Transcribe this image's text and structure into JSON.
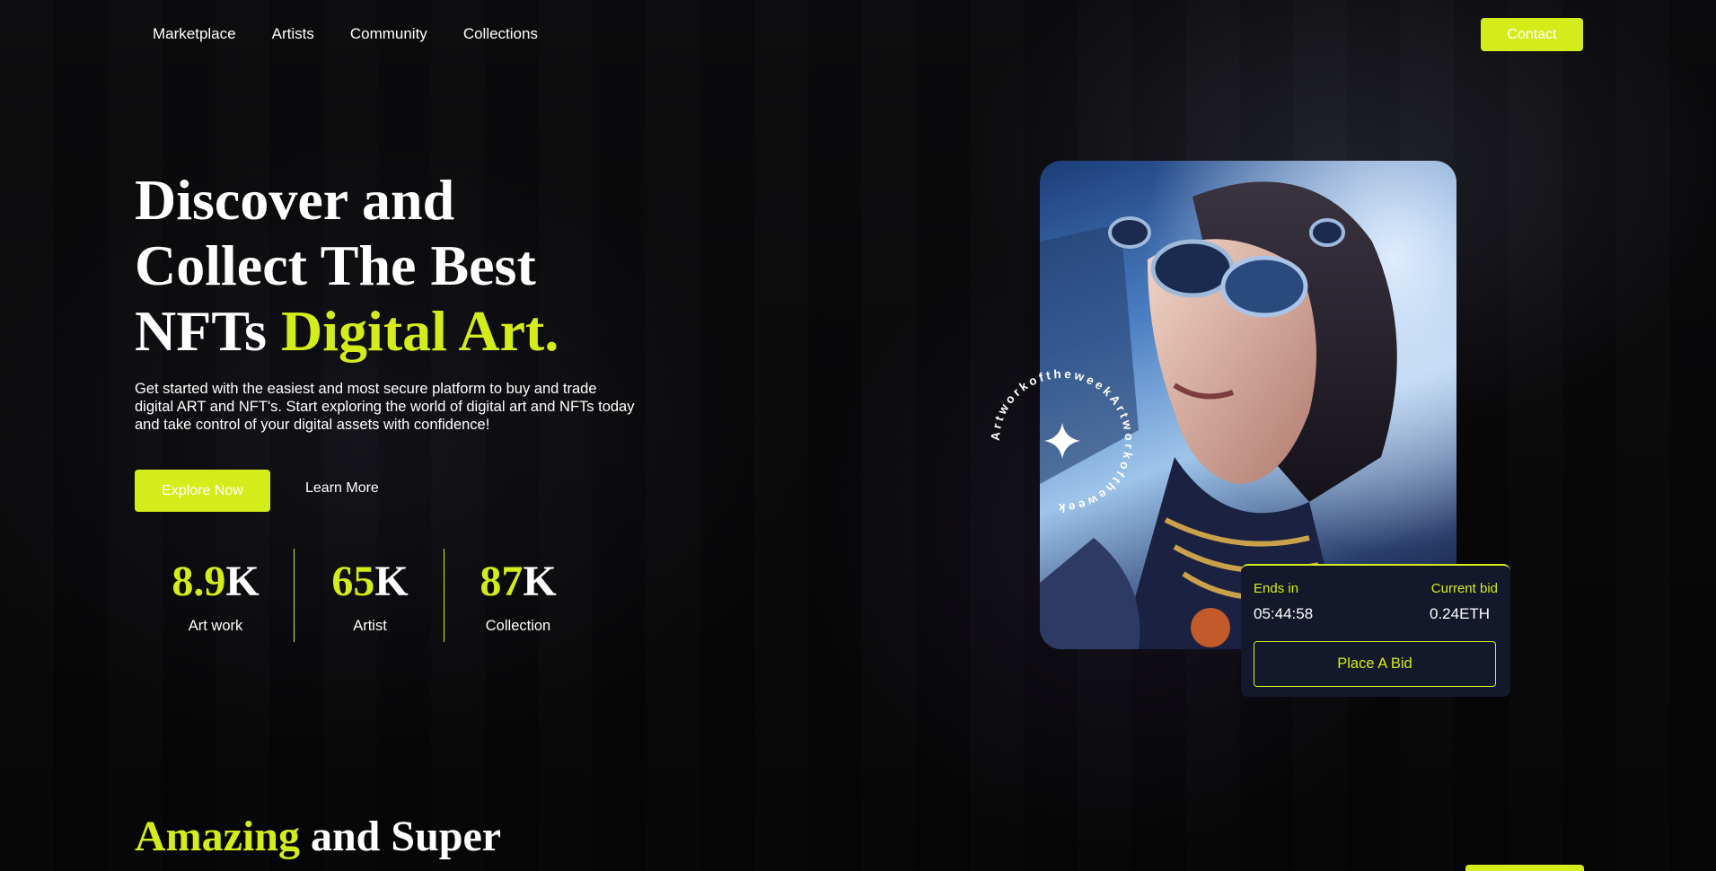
{
  "nav": {
    "items": [
      "Marketplace",
      "Artists",
      "Community",
      "Collections"
    ],
    "contact_label": "Contact"
  },
  "hero": {
    "headline_line1": "Discover and",
    "headline_line2": "Collect The Best",
    "headline_line3_prefix": "NFTs ",
    "headline_line3_accent": "Digital Art.",
    "lead": "Get started with the easiest and most secure platform to buy and trade digital ART and NFT's. Start exploring the world of digital art and NFTs today and take control of your digital assets with confidence!",
    "explore_label": "Explore Now",
    "learn_label": "Learn More"
  },
  "stats": [
    {
      "num": "8.9",
      "suffix": "K",
      "label": "Art work"
    },
    {
      "num": "65",
      "suffix": "K",
      "label": "Artist"
    },
    {
      "num": "87",
      "suffix": "K",
      "label": "Collection"
    }
  ],
  "artwork": {
    "ring_text": "ArtworkoftheweekArtworkoftheweek",
    "icon": "sparkle-icon"
  },
  "bid": {
    "ends_label": "Ends in",
    "ends_value": "05:44:58",
    "current_label": "Current bid",
    "current_value": "0.24ETH",
    "button_label": "Place A Bid"
  },
  "section": {
    "title_accent": "Amazing",
    "title_rest": " and Super"
  },
  "colors": {
    "accent": "#d4ec1a",
    "background": "#0a0a0b",
    "bid_card": "#14182b"
  }
}
